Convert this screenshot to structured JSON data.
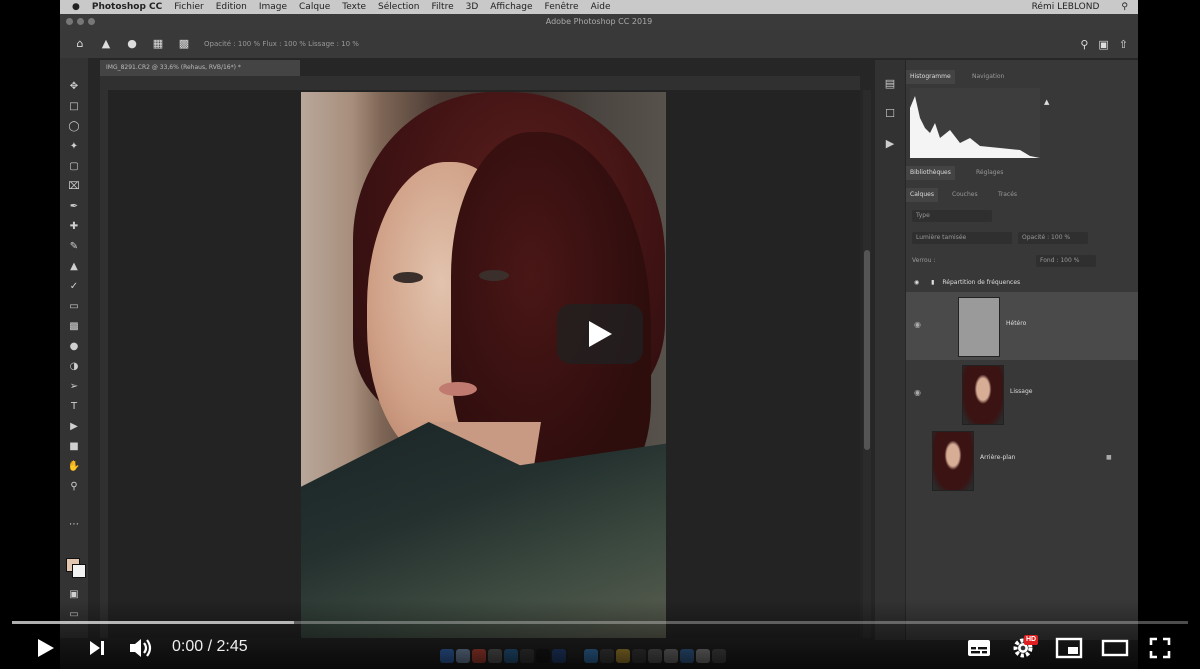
{
  "menubar": {
    "app_name": "Photoshop CC",
    "items": [
      "Fichier",
      "Edition",
      "Image",
      "Calque",
      "Texte",
      "Sélection",
      "Filtre",
      "3D",
      "Affichage",
      "Fenêtre",
      "Aide"
    ],
    "status_user": "Rémi LEBLOND"
  },
  "ps": {
    "window_title": "Adobe Photoshop CC 2019",
    "doc_tab": "IMG_8291.CR2 @ 33,6% (Rehaus, RVB/16*) *",
    "options_text": "Opacité : 100 %    Flux : 100 %    Lissage : 10 %"
  },
  "panels": {
    "top_tabs": [
      "Histogramme",
      "Navigation"
    ],
    "mid_tabs": [
      "Bibliothèques",
      "Réglages"
    ],
    "layer_tabs": [
      "Calques",
      "Couches",
      "Tracés"
    ],
    "filter_label": "Type",
    "blend_mode": "Lumière tamisée",
    "opacity": "Opacité : 100 %",
    "lock_label": "Verrou :",
    "fill": "Fond : 100 %",
    "group_name": "Répartition de fréquences",
    "layers": [
      {
        "name": "Hétéro",
        "selected": true,
        "thumb": "gray"
      },
      {
        "name": "Lissage",
        "selected": false,
        "thumb": "photo"
      },
      {
        "name": "Arrière-plan",
        "selected": false,
        "thumb": "photo"
      }
    ]
  },
  "player": {
    "time_current": "0:00",
    "time_total": "2:45",
    "time_display": "0:00 / 2:45",
    "buffered_fraction": 0.24,
    "hd_badge": "HD"
  }
}
